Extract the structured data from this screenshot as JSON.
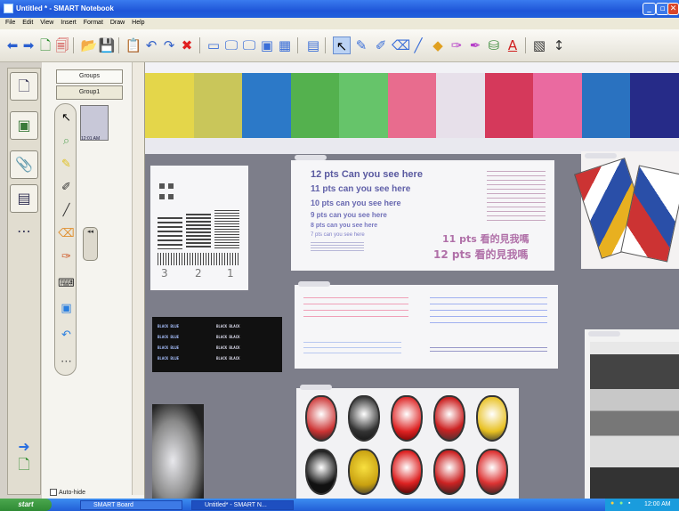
{
  "window": {
    "title": "Untitled * - SMART Notebook"
  },
  "menu": [
    "File",
    "Edit",
    "View",
    "Insert",
    "Format",
    "Draw",
    "Help"
  ],
  "toolbar": {
    "icons": [
      "back-arrow",
      "forward-arrow",
      "add-page",
      "delete-page",
      "open-folder",
      "save",
      "paste",
      "undo",
      "redo",
      "delete",
      "screen-shade",
      "full-screen",
      "dual-page",
      "capture",
      "table",
      "select",
      "pen",
      "creative-pen",
      "eraser",
      "line",
      "shape",
      "magic-pen",
      "shape-recognition",
      "fill",
      "text",
      "properties",
      "move-toolbar"
    ]
  },
  "side_tabs": [
    "page-sorter",
    "gallery",
    "attachments",
    "properties",
    "more"
  ],
  "sorter": {
    "tab1": "Groups",
    "tab2": "Group1",
    "thumbnail_caption": "12:01 AM",
    "autohide_label": "Auto-hide"
  },
  "canvas": {
    "swatch_colors": [
      "#e4d64a",
      "#c9c65a",
      "#2c79c8",
      "#54b14e",
      "#66c46a",
      "#e86c8e",
      "#e7e0ea",
      "#d5395b",
      "#ea6aa0",
      "#2a72c0",
      "#262b88"
    ],
    "res_marks": [
      "3",
      "2",
      "1"
    ],
    "text_lines": [
      "12 pts Can you see here",
      "11 pts can you see here",
      "10 pts can you see here",
      "9 pts can you see here",
      "8 pts can you see here",
      "7 pts can you see here"
    ],
    "cjk_lines": [
      "11 pts 看的見我嗎",
      "12 pts 看的見我嗎"
    ],
    "black_labels": [
      "BLACK BLUE",
      "BLACK BLUE",
      "BLACK BLUE",
      "BLACK BLUE",
      "BLACK BLACK",
      "BLACK BLACK",
      "BLACK BLACK",
      "BLACK BLACK"
    ]
  },
  "taskbar": {
    "start_label": "start",
    "tasks": [
      "SMART Board",
      "Untitled* - SMART N..."
    ],
    "clock": "12:00 AM"
  }
}
